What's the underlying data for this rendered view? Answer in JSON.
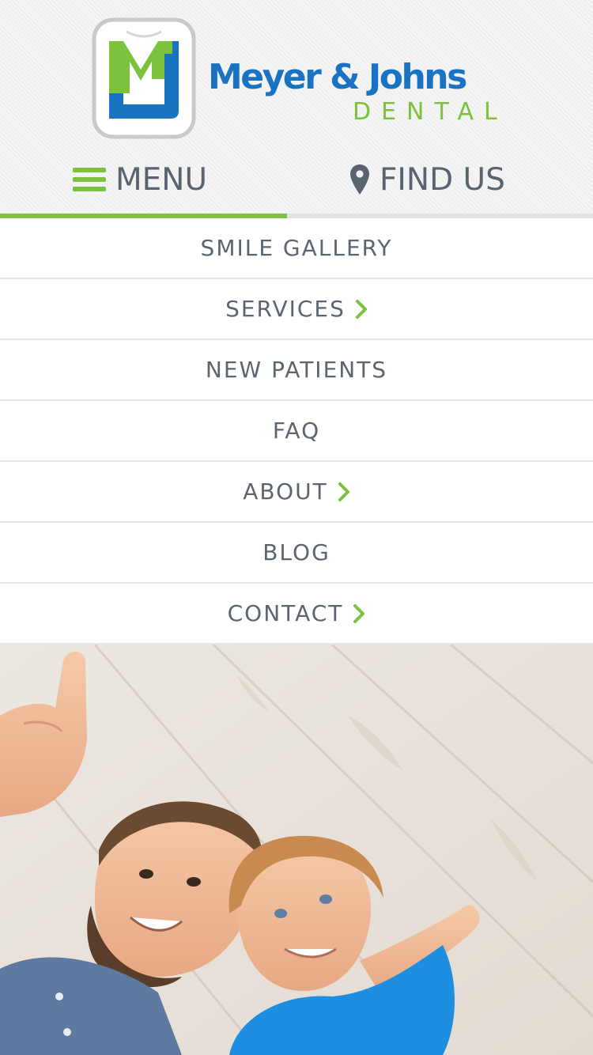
{
  "brand": {
    "logo_letters": "MJ",
    "name": "Meyer & Johns",
    "subtitle": "DENTAL"
  },
  "nav": {
    "menu_label": "MENU",
    "find_label": "FIND US",
    "menu_icon": "hamburger-icon",
    "find_icon": "map-pin-icon",
    "active_tab": "menu"
  },
  "menu": {
    "items": [
      {
        "label": "SMILE GALLERY",
        "has_submenu": false
      },
      {
        "label": "SERVICES",
        "has_submenu": true
      },
      {
        "label": "NEW PATIENTS",
        "has_submenu": false
      },
      {
        "label": "FAQ",
        "has_submenu": false
      },
      {
        "label": "ABOUT",
        "has_submenu": true
      },
      {
        "label": "BLOG",
        "has_submenu": false
      },
      {
        "label": "CONTACT",
        "has_submenu": true
      }
    ]
  },
  "colors": {
    "brand_blue": "#1a72c2",
    "brand_green": "#7cc23c",
    "menu_text": "#5b6570",
    "header_bg": "#f3f3f3"
  },
  "hero": {
    "icon": "father-and-son-photo"
  }
}
